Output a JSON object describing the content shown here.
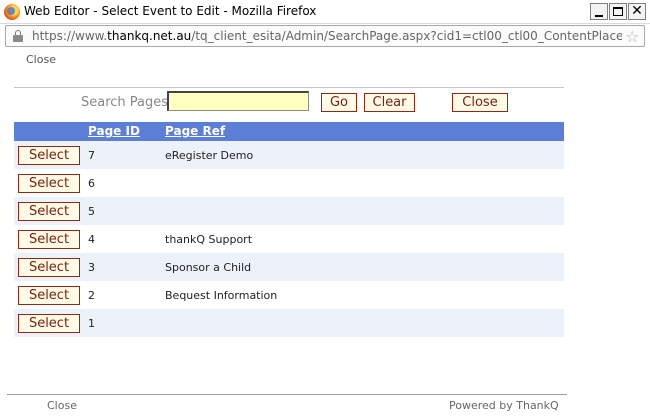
{
  "window": {
    "title": "Web Editor - Select Event to Edit - Mozilla Firefox",
    "url_prefix": "https://www.",
    "url_domain": "thankq.net.au",
    "url_path": "/tq_client_esita/Admin/SearchPage.aspx?cid1=ctl00_ctl00_ContentPlaceHolderMaste"
  },
  "header": {
    "close_link": "Close"
  },
  "search": {
    "label": "Search Pages",
    "value": "",
    "go_label": "Go",
    "clear_label": "Clear",
    "close_label": "Close"
  },
  "grid": {
    "columns": [
      "Page ID",
      "Page Ref"
    ],
    "select_label": "Select",
    "rows": [
      {
        "id": "7",
        "ref": "eRegister Demo"
      },
      {
        "id": "6",
        "ref": ""
      },
      {
        "id": "5",
        "ref": ""
      },
      {
        "id": "4",
        "ref": "thankQ Support"
      },
      {
        "id": "3",
        "ref": "Sponsor a Child"
      },
      {
        "id": "2",
        "ref": "Bequest Information"
      },
      {
        "id": "1",
        "ref": ""
      }
    ]
  },
  "footer": {
    "close_link": "Close",
    "powered_by": "Powered by ThankQ"
  },
  "colors": {
    "header_bg": "#5b7fd6",
    "alt_row_bg": "#edf1fa",
    "button_border": "#8b2b16",
    "input_bg": "#ffffc0"
  }
}
